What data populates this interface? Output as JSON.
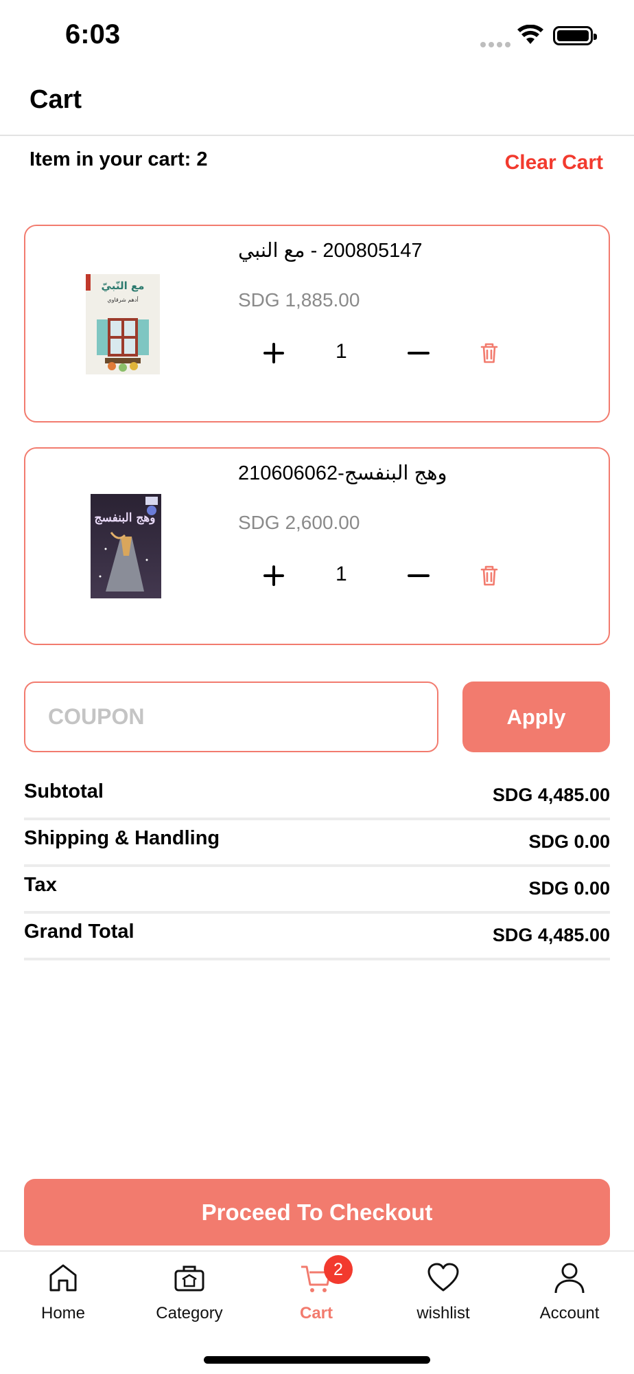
{
  "status_bar": {
    "time": "6:03"
  },
  "header": {
    "title": "Cart"
  },
  "cart": {
    "count_text": "Item in your cart: 2",
    "clear_label": "Clear Cart",
    "items": [
      {
        "name": "200805147 - مع النبي",
        "price": "SDG 1,885.00",
        "quantity": "1",
        "cover_title": "مع النّبيّ",
        "cover_author": "أدهم شرقاوي"
      },
      {
        "name": "وهج البنفسج-210606062",
        "price": "SDG 2,600.00",
        "quantity": "1",
        "cover_title": "وهج البنفسج"
      }
    ]
  },
  "coupon": {
    "placeholder": "COUPON",
    "apply_label": "Apply"
  },
  "summary": {
    "rows": [
      {
        "label": "Subtotal",
        "value": "SDG 4,485.00"
      },
      {
        "label": "Shipping & Handling",
        "value": "SDG 0.00"
      },
      {
        "label": "Tax",
        "value": "SDG 0.00"
      },
      {
        "label": "Grand Total",
        "value": "SDG 4,485.00"
      }
    ]
  },
  "checkout": {
    "label": "Proceed To Checkout"
  },
  "tab_bar": {
    "items": [
      {
        "label": "Home",
        "icon": "home-icon"
      },
      {
        "label": "Category",
        "icon": "category-icon"
      },
      {
        "label": "Cart",
        "icon": "cart-icon",
        "active": true
      },
      {
        "label": "wishlist",
        "icon": "heart-icon"
      },
      {
        "label": "Account",
        "icon": "account-icon"
      }
    ],
    "cart_badge": "2"
  },
  "colors": {
    "accent": "#f27b6e",
    "danger": "#f23a2e",
    "muted": "#8a8a8a"
  }
}
